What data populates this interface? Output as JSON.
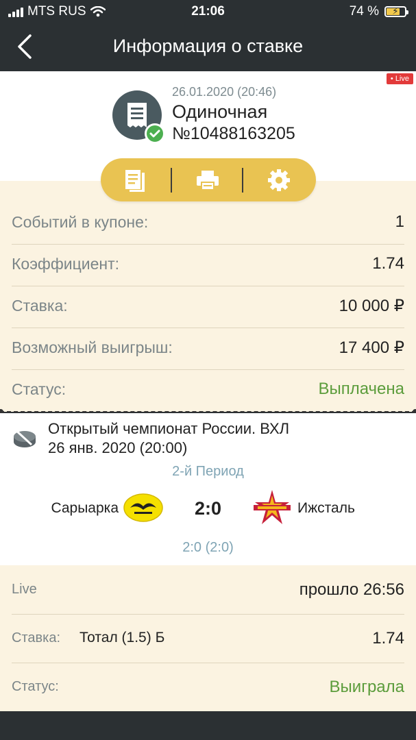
{
  "status_bar": {
    "carrier": "MTS RUS",
    "time": "21:06",
    "battery": "74 %",
    "battery_level": 0.74
  },
  "header": {
    "title": "Информация о ставке"
  },
  "coupon": {
    "live_badge": "• Live",
    "date": "26.01.2020 (20:46)",
    "type": "Одиночная",
    "number": "№10488163205"
  },
  "actions": [
    {
      "icon": "document-icon"
    },
    {
      "icon": "printer-icon"
    },
    {
      "icon": "settings-icon"
    }
  ],
  "summary": [
    {
      "label": "Событий в купоне:",
      "value": "1"
    },
    {
      "label": "Коэффициент:",
      "value": "1.74"
    },
    {
      "label": "Ставка:",
      "value": "10 000 ₽"
    },
    {
      "label": "Возможный выигрыш:",
      "value": "17 400 ₽"
    },
    {
      "label": "Статус:",
      "value": "Выплачена",
      "color": "#5b9c3b"
    }
  ],
  "event": {
    "tournament": "Открытый чемпионат России. ВХЛ",
    "date": "26 янв. 2020 (20:00)",
    "period": "2-й Период",
    "home_team": "Сарыарка",
    "away_team": "Ижсталь",
    "score": "2:0",
    "period_score": "2:0 (2:0)"
  },
  "bet": {
    "live_label": "Live",
    "elapsed": "прошло 26:56",
    "stake_label": "Ставка:",
    "market": "Тотал (1.5) Б",
    "odds": "1.74",
    "status_label": "Статус:",
    "status": "Выиграла",
    "status_color": "#5b9c3b"
  }
}
